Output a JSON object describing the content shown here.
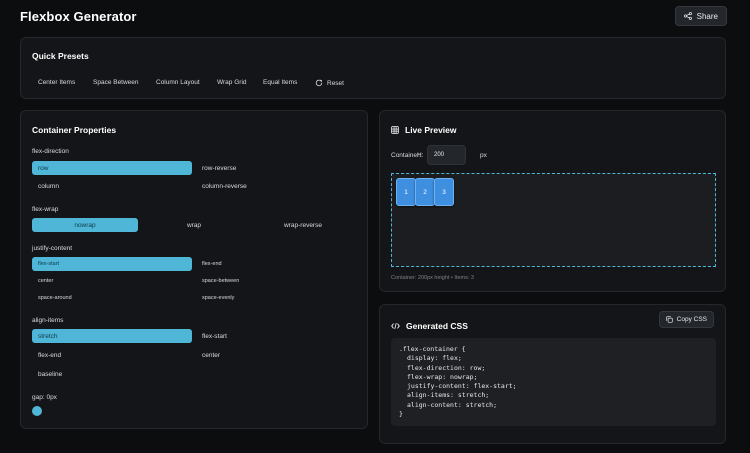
{
  "header": {
    "title": "Flexbox Generator",
    "share_label": "Share"
  },
  "presets": {
    "title": "Quick Presets",
    "items": [
      {
        "label": "Center Items"
      },
      {
        "label": "Space Between"
      },
      {
        "label": "Column Layout"
      },
      {
        "label": "Wrap Grid"
      },
      {
        "label": "Equal Items"
      },
      {
        "label": "Reset",
        "icon": "refresh-icon"
      }
    ]
  },
  "container_props": {
    "title": "Container Properties",
    "flex_direction": {
      "label": "flex-direction",
      "options": [
        "row",
        "row-reverse",
        "column",
        "column-reverse"
      ],
      "selected": "row"
    },
    "flex_wrap": {
      "label": "flex-wrap",
      "options": [
        "nowrap",
        "wrap",
        "wrap-reverse"
      ],
      "selected": "nowrap"
    },
    "justify_content": {
      "label": "justify-content",
      "options": [
        "flex-start",
        "flex-end",
        "center",
        "space-between",
        "space-around",
        "space-evenly"
      ],
      "selected": "flex-start"
    },
    "align_items": {
      "label": "align-items",
      "options": [
        "stretch",
        "flex-start",
        "flex-end",
        "center",
        "baseline"
      ],
      "selected": "stretch"
    },
    "gap": {
      "label": "gap: 0px",
      "value": 0
    }
  },
  "preview": {
    "title": "Live Preview",
    "container_label": "Container:",
    "height_label": "H:",
    "height_value": "200",
    "unit": "px",
    "items": [
      "1",
      "2",
      "3"
    ],
    "caption": "Container: 200px height • Items: 3"
  },
  "css": {
    "title": "Generated CSS",
    "copy_label": "Copy CSS",
    "lines": [
      ".flex-container {",
      "display: flex;",
      "flex-direction: row;",
      "flex-wrap: nowrap;",
      "justify-content: flex-start;",
      "align-items: stretch;",
      "align-content: stretch;",
      "}"
    ]
  },
  "colors": {
    "accent": "#4fb6d8",
    "item": "#3f8fe0",
    "background": "#0c0d0f",
    "card": "#141518"
  }
}
